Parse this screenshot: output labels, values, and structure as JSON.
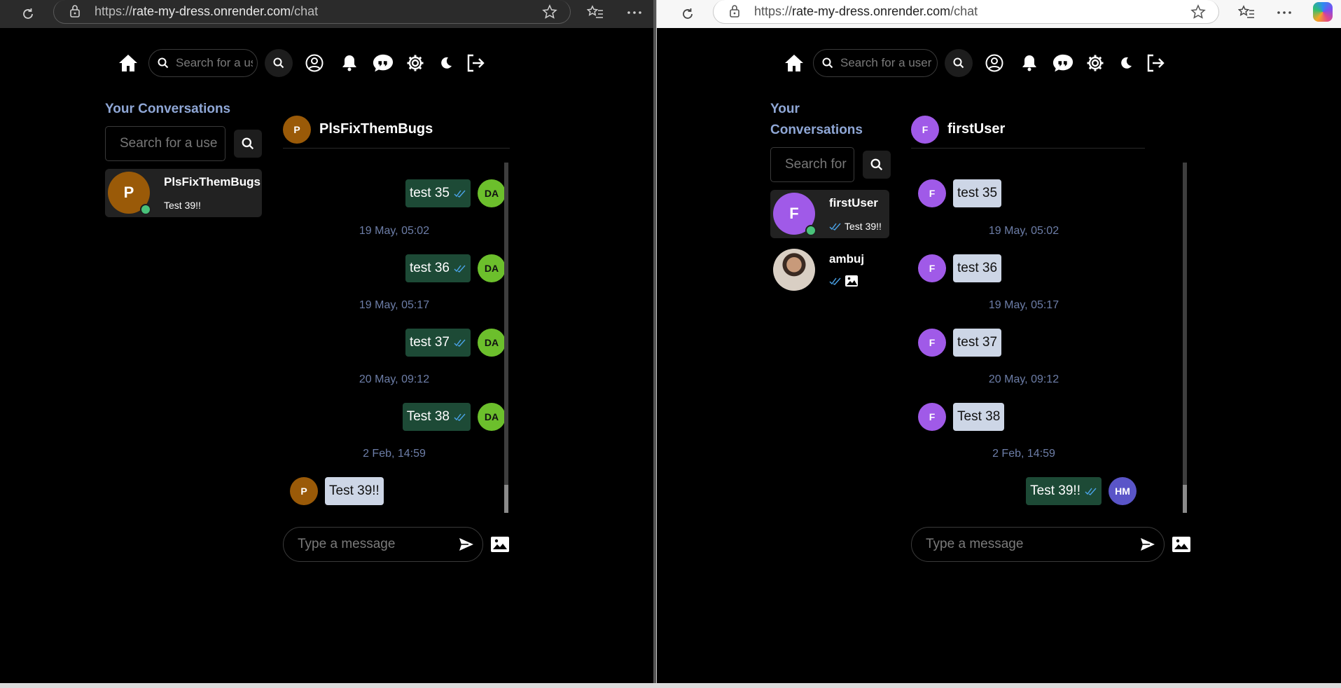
{
  "browser_left": {
    "url_prefix": "https://",
    "url_domain": "rate-my-dress.onrender.com",
    "url_path": "/chat"
  },
  "browser_right": {
    "url_prefix": "https://",
    "url_domain": "rate-my-dress.onrender.com",
    "url_path": "/chat"
  },
  "left": {
    "nav_search_placeholder": "Search for a user",
    "sidebar_title": "Your Conversations",
    "sidebar_search_placeholder": "Search for a user",
    "conversations": [
      {
        "avatar": "P",
        "name": "PlsFixThemBugs",
        "preview": "Test 39!!",
        "online": true,
        "avatar_color": "#9a5a08"
      }
    ],
    "chat_header": {
      "avatar": "P",
      "name": "PlsFixThemBugs",
      "avatar_color": "#9a5a08"
    },
    "messages": [
      {
        "text": "test 35",
        "dir": "out",
        "avatar": "DA"
      },
      {
        "stamp": "19 May, 05:02"
      },
      {
        "text": "test 36",
        "dir": "out",
        "avatar": "DA"
      },
      {
        "stamp": "19 May, 05:17"
      },
      {
        "text": "test 37",
        "dir": "out",
        "avatar": "DA"
      },
      {
        "stamp": "20 May, 09:12"
      },
      {
        "text": "Test 38",
        "dir": "out",
        "avatar": "DA"
      },
      {
        "stamp": "2 Feb, 14:59"
      },
      {
        "text": "Test 39!!",
        "dir": "in",
        "avatar": "P"
      }
    ],
    "composer_placeholder": "Type a message",
    "colors": {
      "me_avatar": "#6cbf2c",
      "them_avatar": "#9a5a08"
    }
  },
  "right": {
    "nav_search_placeholder": "Search for a user",
    "sidebar_title_line1": "Your",
    "sidebar_title_line2": "Conversations",
    "sidebar_search_placeholder": "Search for a user",
    "conversations": [
      {
        "avatar": "F",
        "name": "firstUser",
        "preview": "Test 39!!",
        "online": true,
        "avatar_color": "#a05ae8"
      },
      {
        "avatar": "photo",
        "name": "ambuj",
        "preview": "image",
        "online": false
      }
    ],
    "chat_header": {
      "avatar": "F",
      "name": "firstUser",
      "avatar_color": "#a05ae8"
    },
    "messages": [
      {
        "text": "test 35",
        "dir": "in",
        "avatar": "F"
      },
      {
        "stamp": "19 May, 05:02"
      },
      {
        "text": "test 36",
        "dir": "in",
        "avatar": "F"
      },
      {
        "stamp": "19 May, 05:17"
      },
      {
        "text": "test 37",
        "dir": "in",
        "avatar": "F"
      },
      {
        "stamp": "20 May, 09:12"
      },
      {
        "text": "Test 38",
        "dir": "in",
        "avatar": "F"
      },
      {
        "stamp": "2 Feb, 14:59"
      },
      {
        "text": "Test 39!!",
        "dir": "out",
        "avatar": "HM"
      }
    ],
    "composer_placeholder": "Type a message",
    "colors": {
      "me_avatar": "#5a55c8",
      "them_avatar": "#a05ae8"
    }
  }
}
